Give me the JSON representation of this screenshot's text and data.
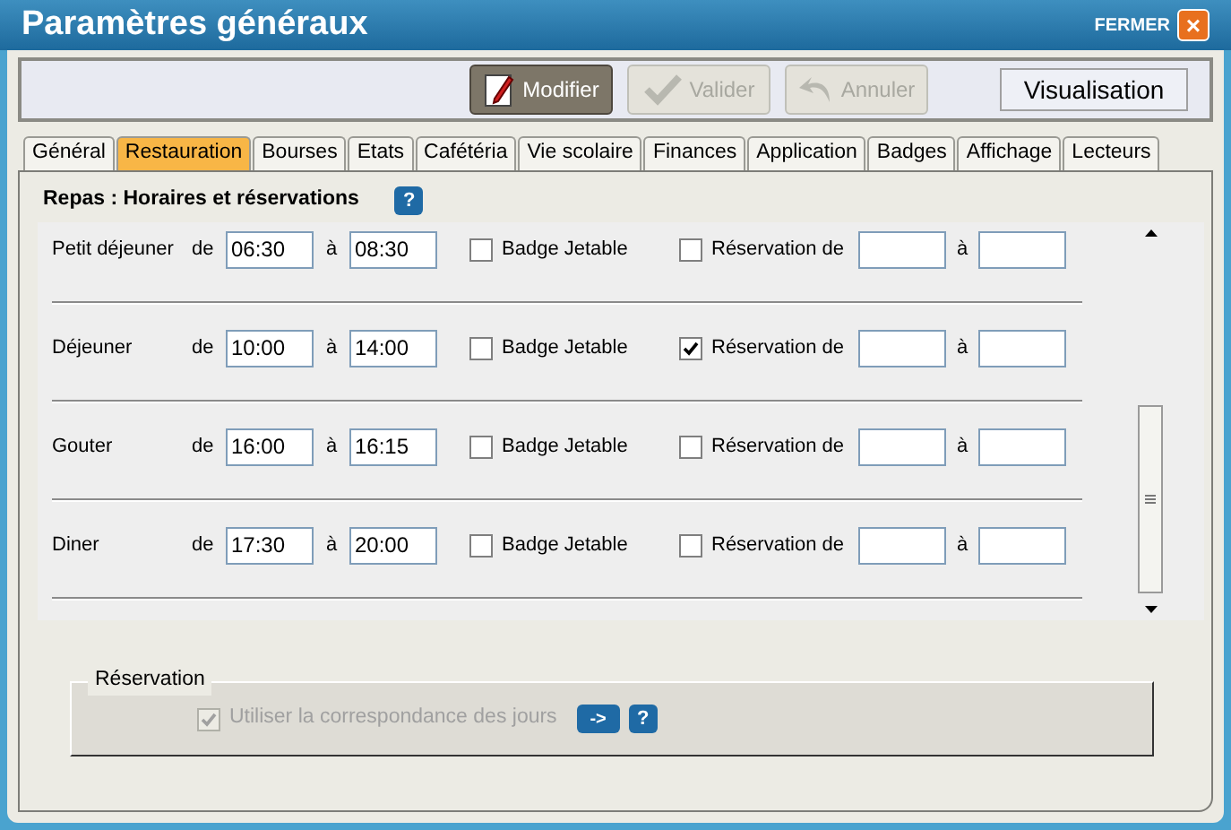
{
  "window": {
    "title": "Paramètres généraux",
    "close_label": "FERMER",
    "close_glyph": "×"
  },
  "toolbar": {
    "buttons": [
      {
        "label": "Modifier",
        "kind": "edit",
        "disabled": false
      },
      {
        "label": "Valider",
        "kind": "check",
        "disabled": true
      },
      {
        "label": "Annuler",
        "kind": "undo",
        "disabled": true
      }
    ],
    "mode": "Visualisation"
  },
  "tabs": [
    {
      "label": "Général",
      "selected": false
    },
    {
      "label": "Restauration",
      "selected": true
    },
    {
      "label": "Bourses",
      "selected": false
    },
    {
      "label": "Etats",
      "selected": false
    },
    {
      "label": "Cafétéria",
      "selected": false
    },
    {
      "label": "Vie scolaire",
      "selected": false
    },
    {
      "label": "Finances",
      "selected": false
    },
    {
      "label": "Application",
      "selected": false
    },
    {
      "label": "Badges",
      "selected": false
    },
    {
      "label": "Affichage",
      "selected": false
    },
    {
      "label": "Lecteurs",
      "selected": false
    }
  ],
  "section": {
    "title": "Repas : Horaires et réservations",
    "help": "?"
  },
  "meals": [
    {
      "name": "Petit déjeuner",
      "de": "de",
      "from": "06:30",
      "a": "à",
      "to": "08:30",
      "badge_label": "Badge Jetable",
      "badge": false,
      "reservation_label": "Réservation de",
      "reservation": false,
      "a2": "à"
    },
    {
      "name": "Déjeuner",
      "de": "de",
      "from": "10:00",
      "a": "à",
      "to": "14:00",
      "badge_label": "Badge Jetable",
      "badge": false,
      "reservation_label": "Réservation de",
      "reservation": true,
      "a2": "à"
    },
    {
      "name": "Gouter",
      "de": "de",
      "from": "16:00",
      "a": "à",
      "to": "16:15",
      "badge_label": "Badge Jetable",
      "badge": false,
      "reservation_label": "Réservation de",
      "reservation": false,
      "a2": "à"
    },
    {
      "name": "Diner",
      "de": "de",
      "from": "17:30",
      "a": "à",
      "to": "20:00",
      "badge_label": "Badge Jetable",
      "badge": false,
      "reservation_label": "Réservation de",
      "reservation": false,
      "a2": "à"
    }
  ],
  "reservation_group": {
    "title": "Réservation",
    "option": {
      "label": "Utiliser la correspondance des jours",
      "checked": true,
      "disabled": true
    },
    "go": "->",
    "help": "?"
  }
}
